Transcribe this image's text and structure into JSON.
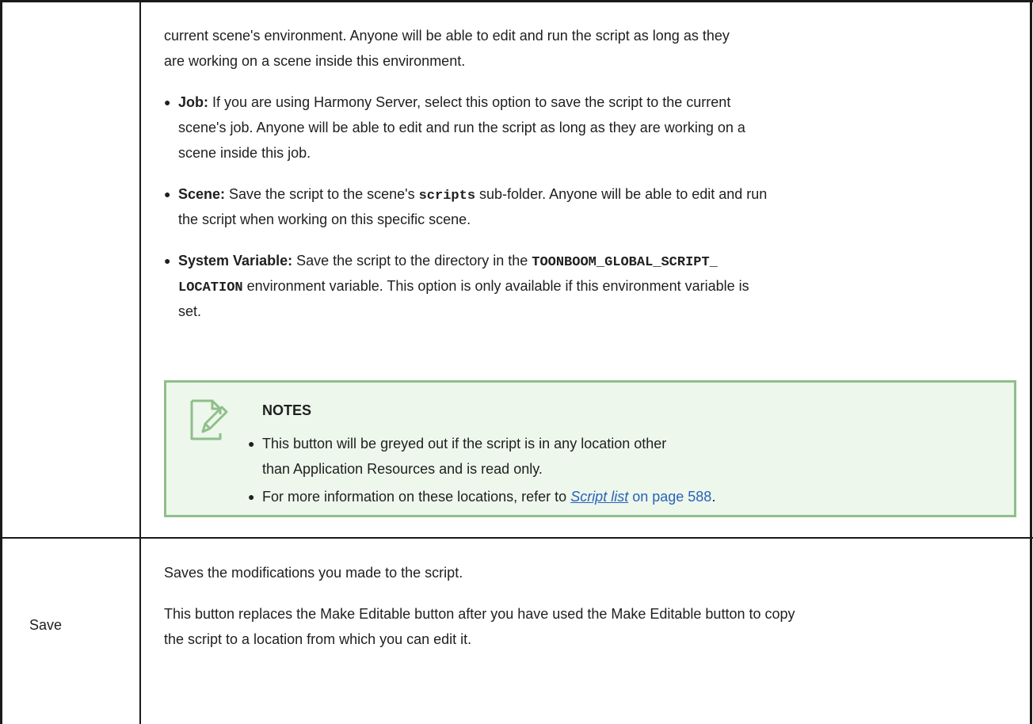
{
  "row1": {
    "intro_lines": [
      "current scene's environment. Anyone will be able to edit and run the script as long as they",
      "are working on a scene inside this environment."
    ],
    "job": {
      "label": "Job:",
      "line1": " If you are using Harmony Server, select this option to save the script to the current",
      "line2": "scene's job. Anyone will be able to edit and run the script as long as they are working on a",
      "line3": "scene inside this job."
    },
    "scene": {
      "label": "Scene:",
      "text_before": " Save the script to the scene's ",
      "code": "scripts",
      "text_after": " sub-folder. Anyone will be able to edit and run",
      "line2": "the script when working on this specific scene."
    },
    "sysvar": {
      "label": "System Variable:",
      "text_before": " Save the script to the directory in the ",
      "code1": "TOONBOOM_GLOBAL_SCRIPT_",
      "code2": "LOCATION",
      "line2_after": " environment variable. This option is only available if this environment variable is",
      "line3": "set."
    },
    "notes": {
      "title": "NOTES",
      "icon": "note-pencil-icon",
      "item1_line1": "This button will be greyed out if the script is in any location other",
      "item1_line2": "than Application Resources and is read only.",
      "item2_before": "For more information on these locations, refer to ",
      "item2_link": "Script list",
      "item2_page": " on page 588",
      "item2_end": "."
    }
  },
  "row2": {
    "label": "Save",
    "desc1": "Saves the modifications you made to the script.",
    "desc2_line1": "This button replaces the Make Editable button after you have used the Make Editable button to copy",
    "desc2_line2": "the script to a location from which you can edit it."
  },
  "colors": {
    "notes_border": "#8fbf8a",
    "notes_bg": "#edf7ec",
    "link": "#2b62b8"
  }
}
